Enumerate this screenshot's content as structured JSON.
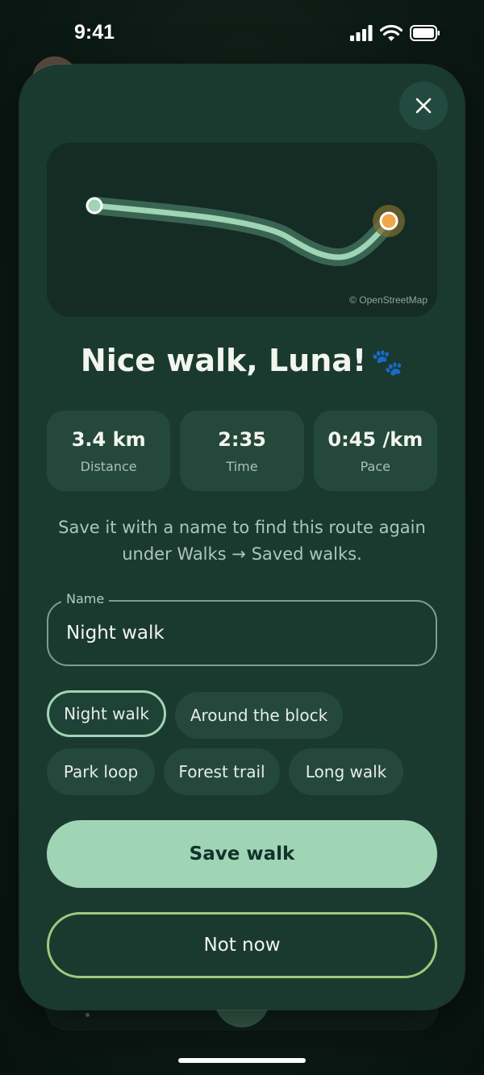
{
  "status_bar": {
    "time": "9:41"
  },
  "map": {
    "attribution": "© OpenStreetMap"
  },
  "title": {
    "text": "Nice walk, Luna!",
    "emoji": "🐾"
  },
  "stats": [
    {
      "value": "3.4 km",
      "label": "Distance"
    },
    {
      "value": "2:35",
      "label": "Time"
    },
    {
      "value": "0:45 /km",
      "label": "Pace"
    }
  ],
  "hint": {
    "line1": "Save it with a name to find this route again",
    "line2": "under Walks → Saved walks."
  },
  "name_field": {
    "label": "Name",
    "value": "Night walk"
  },
  "suggestions": [
    "Night walk",
    "Around the block",
    "Park loop",
    "Forest trail",
    "Long walk"
  ],
  "selected_suggestion": "Night walk",
  "actions": {
    "save": "Save walk",
    "dismiss": "Not now"
  },
  "colors": {
    "sheet": "#1a3a30",
    "accent": "#9fd4b4",
    "secondary_outline": "#a5c77e",
    "route": "#9fd4b4",
    "end_marker": "#f0a64a"
  },
  "icons": [
    "signal-icon",
    "wifi-icon",
    "battery-icon",
    "close-icon",
    "paw-icon"
  ]
}
